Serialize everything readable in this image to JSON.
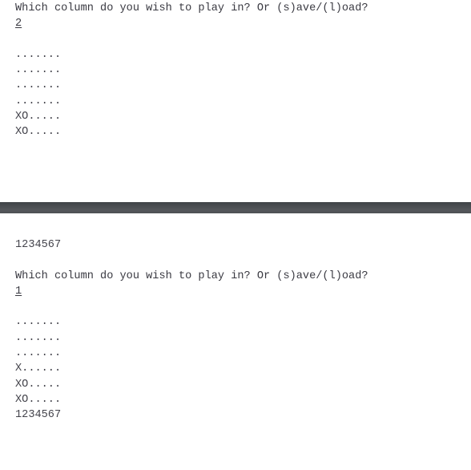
{
  "app": {
    "title": "Connect Four terminal session",
    "text_color": "#3a3a42",
    "background_color": "#ffffff",
    "divider_color": "#4a4d51"
  },
  "sessions": [
    {
      "id": "top-session",
      "prompt": "Which column do you wish to play in? Or (s)ave/(l)oad?",
      "input": "2",
      "board": [
        ".......",
        ".......",
        ".......",
        ".......",
        "XO.....",
        "XO....."
      ],
      "column_labels": ""
    },
    {
      "id": "bottom-session",
      "column_labels_top": "1234567",
      "prompt": "Which column do you wish to play in? Or (s)ave/(l)oad?",
      "input": "1",
      "board": [
        ".......",
        ".......",
        ".......",
        "X......",
        "XO.....",
        "XO....."
      ],
      "column_labels": "1234567"
    }
  ]
}
